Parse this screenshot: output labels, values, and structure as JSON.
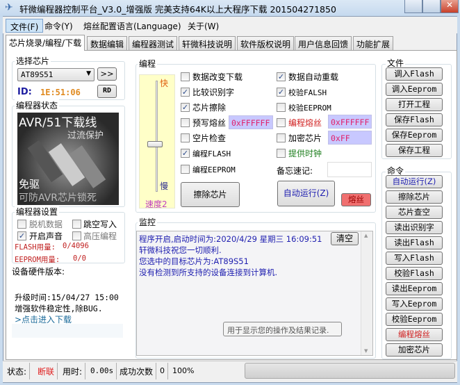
{
  "window": {
    "title": "轩微编程器控制平台_V3.0_增强版 完美支持64K以上大程序下载 201504271850"
  },
  "menu": [
    "文件(F)",
    "命令(Y)",
    "熔丝配置语言(Language)",
    "关于(W)"
  ],
  "tabs": [
    "芯片烧录/编程/下载",
    "数据编辑",
    "编程器测试",
    "轩微科技说明",
    "软件版权说明",
    "用户信息回馈",
    "功能扩展"
  ],
  "chip": {
    "group": "选择芯片",
    "selected": "AT89S51",
    "next_label": ">>",
    "id_label": "ID:",
    "id_value": "1E:51:06",
    "rd_label": "RD"
  },
  "status_group": {
    "label": "编程器状态",
    "image_text1": "AVR/51下载线",
    "image_text2": "过流保护",
    "image_text3": "免驱",
    "image_text4": "可防AVR芯片锁死"
  },
  "settings": {
    "label": "编程器设置",
    "items": [
      {
        "label": "脱机数据",
        "checked": false
      },
      {
        "label": "跳空写入",
        "checked": false
      },
      {
        "label": "开启声音",
        "checked": true
      },
      {
        "label": "高压编程",
        "checked": false
      }
    ],
    "flash_label": "FLASH用量:",
    "flash_value": "0/4096",
    "eeprom_label": "EEPROM用量:",
    "eeprom_value": "0/0"
  },
  "hardware": {
    "label": "设备硬件版本:",
    "update": "升级时间:15/04/27 15:00",
    "note": "增强软件稳定性,除BUG.",
    "link": ">点击进入下载"
  },
  "program": {
    "label": "编程",
    "speed_fast": "快",
    "speed_slow": "慢",
    "speed_label": "速度2",
    "left": [
      {
        "label": "数据改变下载",
        "checked": false
      },
      {
        "label": "比较识别字",
        "checked": true
      },
      {
        "label": "芯片擦除",
        "checked": true
      },
      {
        "label": "预写熔丝",
        "checked": false
      },
      {
        "label": "空片检查",
        "checked": false
      },
      {
        "label": "编程FLASH",
        "checked": true
      },
      {
        "label": "编程EEPROM",
        "checked": false
      }
    ],
    "right": [
      {
        "label": "数据自动重载",
        "checked": true
      },
      {
        "label": "校验FALSH",
        "checked": true
      },
      {
        "label": "校验EEPROM",
        "checked": false
      },
      {
        "label": "编程熔丝",
        "checked": false
      },
      {
        "label": "加密芯片",
        "checked": false
      },
      {
        "label": "提供时钟",
        "checked": false
      }
    ],
    "prefuse_value": "0xFFFFFF",
    "fuse_value": "0xFFFFFF",
    "lock_value": "0xFF",
    "memo_label": "备忘速记:",
    "memo_value": "",
    "erase_btn": "擦除芯片",
    "auto_btn": "自动运行(Z)",
    "fuse_btn": "熔丝"
  },
  "monitor": {
    "label": "监控",
    "clear_btn": "清空",
    "lines": [
      "程序开启,启动时间为:2020/4/29 星期三 16:09:51",
      "轩微科技祝您一切顺利.",
      "您选中的目标芯片为:AT89S51",
      "没有检测到所支持的设备连接到计算机."
    ],
    "hint": "用于显示您的操作及结果记录."
  },
  "file_group": {
    "label": "文件",
    "buttons": [
      "调入Flash",
      "调入Eeprom",
      "打开工程",
      "保存Flash",
      "保存Eeprom",
      "保存工程"
    ]
  },
  "cmd_group": {
    "label": "命令",
    "buttons": [
      "自动运行(Z)",
      "擦除芯片",
      "芯片查空",
      "读出识别字",
      "读出Flash",
      "写入Flash",
      "校验Flash",
      "读出Eeprom",
      "写入Eeprom",
      "校验Eeprom",
      "编程熔丝",
      "加密芯片"
    ]
  },
  "statusbar": {
    "state_label": "状态:",
    "state_value": "断联",
    "time_label": "用时:",
    "time_value": "0.00s",
    "success_label": "成功次数",
    "success_value": "0",
    "percent": "100%",
    "progress": 0
  },
  "colors": {
    "accent_blue": "#2020c0",
    "red": "#d02020",
    "fuse_btn": "#f07070"
  }
}
